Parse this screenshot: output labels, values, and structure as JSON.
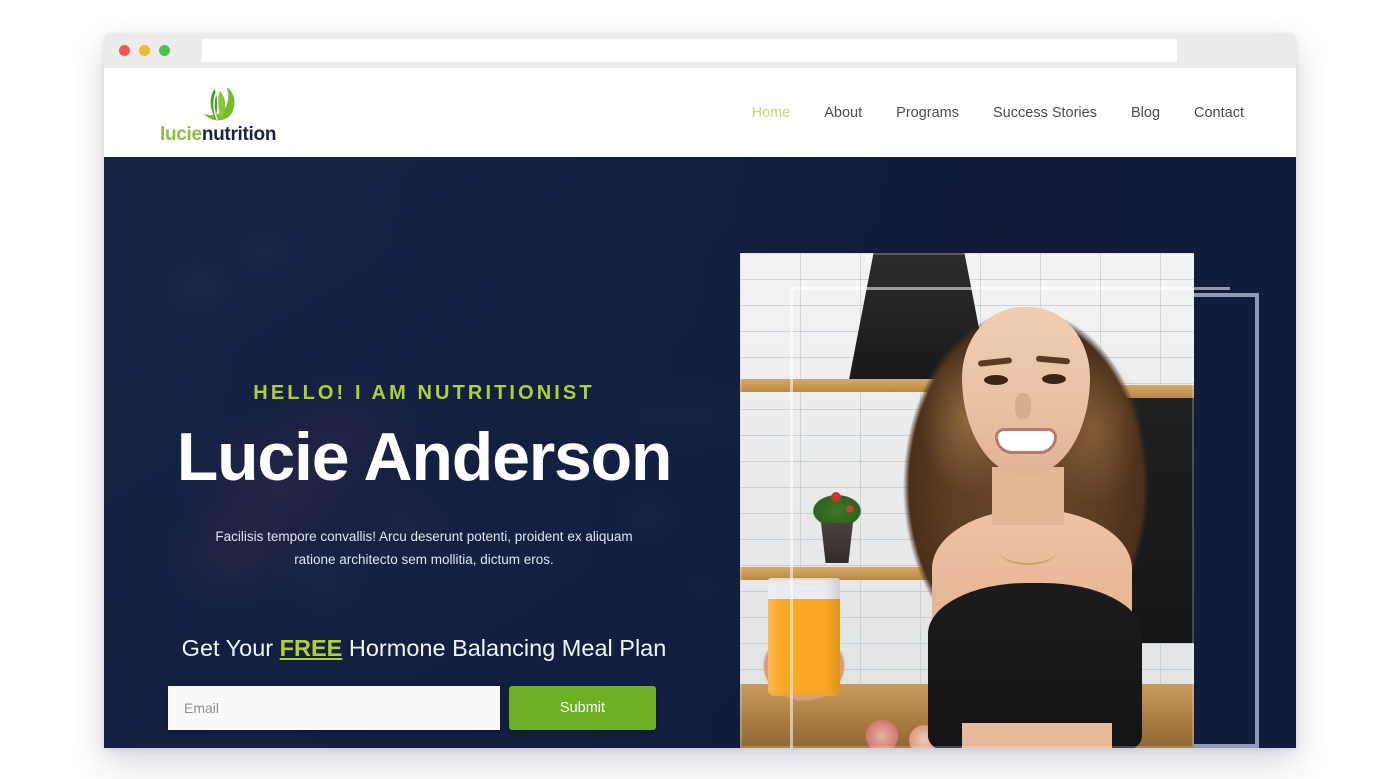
{
  "browser": {
    "url_value": "",
    "url_placeholder": "",
    "dots": [
      {
        "name": "close",
        "color": "#f0574f"
      },
      {
        "name": "minimize",
        "color": "#f7b731"
      },
      {
        "name": "maximize",
        "color": "#44c453"
      }
    ]
  },
  "site": {
    "logo": {
      "icon": "leaf-circle-icon",
      "text_primary": "lucie",
      "text_secondary": "nutrition",
      "color_primary": "#8cbf3f",
      "color_secondary": "#1b2340"
    },
    "nav": {
      "items": [
        {
          "label": "Home",
          "active": true
        },
        {
          "label": "About",
          "active": false
        },
        {
          "label": "Programs",
          "active": false
        },
        {
          "label": "Success Stories",
          "active": false
        },
        {
          "label": "Blog",
          "active": false
        },
        {
          "label": "Contact",
          "active": false
        }
      ],
      "active_color": "#c2d96b",
      "inactive_color": "#4c4c4c"
    }
  },
  "hero": {
    "eyebrow": "HELLO! I AM NUTRITIONIST",
    "name": "Lucie Anderson",
    "description": "Facilisis tempore convallis! Arcu deserunt potenti, proident ex aliquam ratione architecto sem mollitia, dictum eros.",
    "cta": {
      "prefix": "Get Your ",
      "emphasis": "FREE",
      "suffix": " Hormone Balancing Meal Plan"
    },
    "form": {
      "email_value": "",
      "email_placeholder": "Email",
      "submit_label": "Submit"
    },
    "colors": {
      "background": "#16244a",
      "accent_green": "#b0d12f",
      "button_green": "#6cb024",
      "deco_outline": "#8e9bb4"
    },
    "photo": {
      "alt": "smiling woman holding glass of orange juice in kitchen"
    }
  }
}
